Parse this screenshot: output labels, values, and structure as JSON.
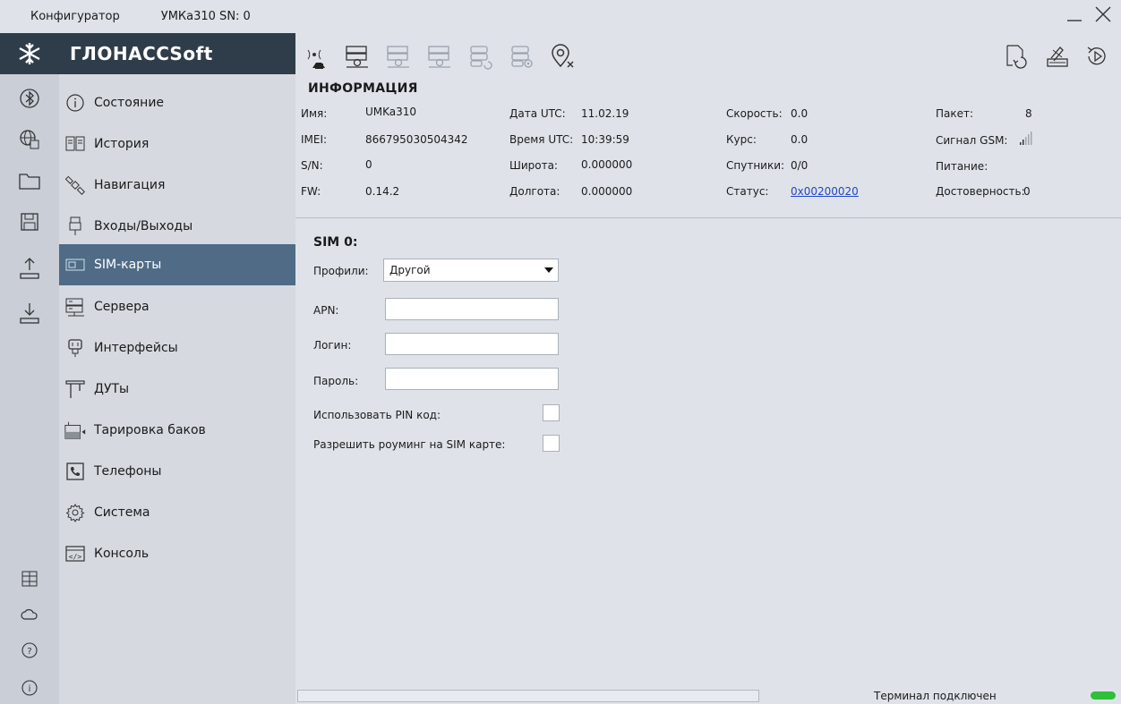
{
  "window": {
    "app_title": "Конфигуратор",
    "device_title": "УМКа310 SN: 0"
  },
  "brand": {
    "name": "ГЛОНАССSoft"
  },
  "rail_icons": [
    "bluetooth-icon",
    "network-globe-icon",
    "folder-icon",
    "save-icon",
    "upload-icon",
    "download-icon",
    "grid-icon",
    "cloud-icon",
    "help-icon",
    "info-icon"
  ],
  "nav": {
    "items": [
      {
        "label": "Состояние",
        "icon": "info-circle-icon"
      },
      {
        "label": "История",
        "icon": "book-icon"
      },
      {
        "label": "Навигация",
        "icon": "satellite-icon"
      },
      {
        "label": "Входы/Выходы",
        "icon": "plug-icon"
      },
      {
        "label": "SIM-карты",
        "icon": "sim-card-icon"
      },
      {
        "label": "Сервера",
        "icon": "server-icon"
      },
      {
        "label": "Интерфейсы",
        "icon": "connector-icon"
      },
      {
        "label": "ДУТы",
        "icon": "fuel-sensor-icon"
      },
      {
        "label": "Тарировка баков",
        "icon": "tank-icon"
      },
      {
        "label": "Телефоны",
        "icon": "phone-icon"
      },
      {
        "label": "Система",
        "icon": "gear-icon"
      },
      {
        "label": "Консоль",
        "icon": "console-icon"
      }
    ],
    "active_index": 4
  },
  "toolbar": {
    "left_icons": [
      "antenna-home-icon",
      "server-location-icon",
      "server-location-2-icon",
      "server-location-3-icon",
      "database-refresh-icon",
      "database-settings-icon",
      "location-off-icon"
    ],
    "right_icons": [
      "reload-file-icon",
      "firmware-icon",
      "reset-icon"
    ]
  },
  "info": {
    "title": "ИНФОРМАЦИЯ",
    "fields": [
      {
        "label": "Имя:",
        "value": "UMKa310"
      },
      {
        "label": "IMEI:",
        "value": "866795030504342"
      },
      {
        "label": "S/N:",
        "value": "0"
      },
      {
        "label": "FW:",
        "value": "0.14.2"
      },
      {
        "label": "Дата UTC:",
        "value": "11.02.19"
      },
      {
        "label": "Время UTC:",
        "value": "10:39:59"
      },
      {
        "label": "Широта:",
        "value": "0.000000"
      },
      {
        "label": "Долгота:",
        "value": "0.000000"
      },
      {
        "label": "Скорость:",
        "value": "0.0"
      },
      {
        "label": "Курс:",
        "value": "0.0"
      },
      {
        "label": "Спутники:",
        "value": "0/0"
      },
      {
        "label": "Статус:",
        "value": "0x00200020"
      },
      {
        "label": "Пакет:",
        "value": "8"
      },
      {
        "label": "Сигнал GSM:",
        "value": ""
      },
      {
        "label": "Питание:",
        "value": ""
      },
      {
        "label": "Достоверность:",
        "value": "0"
      }
    ]
  },
  "form": {
    "sim_title": "SIM 0:",
    "profiles_label": "Профили:",
    "profiles_value": "Другой",
    "apn_label": "APN:",
    "apn_value": "",
    "login_label": "Логин:",
    "login_value": "",
    "password_label": "Пароль:",
    "password_value": "",
    "pin_label": "Использовать PIN код:",
    "pin_checked": false,
    "roaming_label": "Разрешить роуминг на SIM карте:",
    "roaming_checked": false
  },
  "statusbar": {
    "text": "Терминал подключен",
    "progress": 0,
    "led_color": "#2fbf3a"
  },
  "colors": {
    "brand_bg": "#2f3d4a",
    "active_bg": "#4f6b86",
    "link": "#2346c8"
  }
}
